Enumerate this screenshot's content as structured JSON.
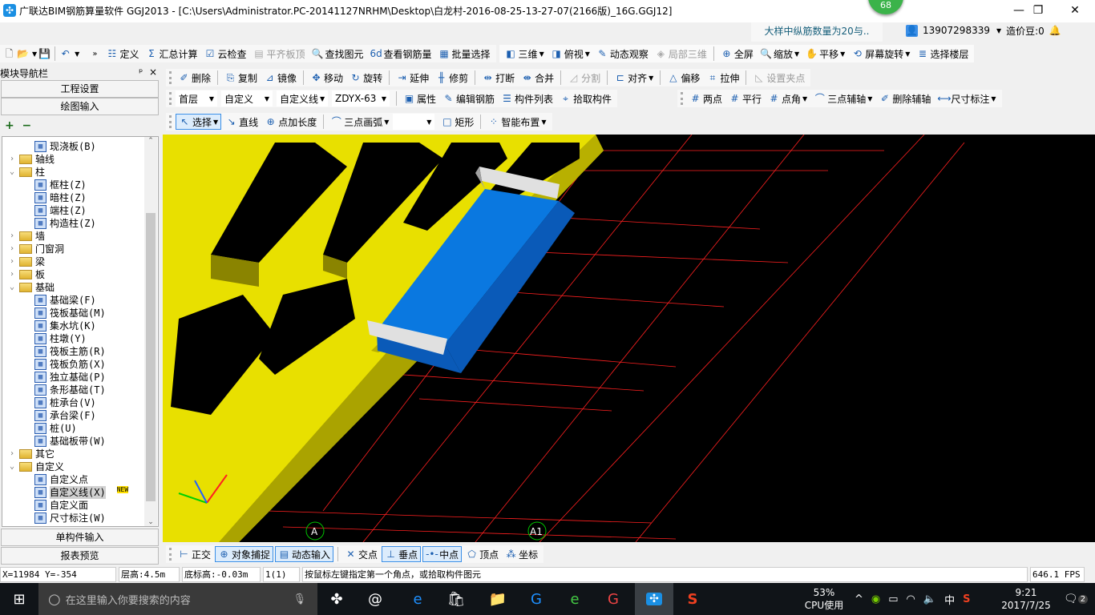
{
  "title": "广联达BIM钢筋算量软件 GGJ2013 - [C:\\Users\\Administrator.PC-20141127NRHM\\Desktop\\白龙村-2016-08-25-13-27-07(2166版)_16G.GGJ12]",
  "badge": "68",
  "window_controls": {
    "minimize": "—",
    "restore": "❐",
    "close": "✕"
  },
  "notice": "大样中纵筋数量为20与..",
  "user": "13907298339",
  "beans": "造价豆:0",
  "toolbar1": [
    "定义",
    "汇总计算",
    "云检查",
    "平齐板顶",
    "查找图元",
    "查看钢筋量",
    "批量选择"
  ],
  "toolbar_view": [
    "三维",
    "俯视",
    "动态观察",
    "局部三维",
    "全屏",
    "缩放",
    "平移",
    "屏幕旋转",
    "选择楼层"
  ],
  "toolbar_edit": [
    "删除",
    "复制",
    "镜像",
    "移动",
    "旋转",
    "延伸",
    "修剪",
    "打断",
    "合并",
    "分割",
    "对齐",
    "偏移",
    "拉伸",
    "设置夹点"
  ],
  "combos": {
    "floor": "首层",
    "type": "自定义",
    "subtype": "自定义线",
    "name": "ZDYX-63"
  },
  "toolbar_prop": [
    "属性",
    "编辑钢筋",
    "构件列表",
    "拾取构件"
  ],
  "toolbar_axis": [
    "两点",
    "平行",
    "点角",
    "三点辅轴",
    "删除辅轴",
    "尺寸标注"
  ],
  "toolbar_draw": [
    "选择",
    "直线",
    "点加长度",
    "三点画弧",
    "矩形",
    "智能布置"
  ],
  "left": {
    "header": "模块导航栏",
    "pin": "ᵖ",
    "close": "×",
    "project": "工程设置",
    "draw": "绘图输入",
    "single": "单构件输入",
    "report": "报表预览",
    "add": "+",
    "remove": "−"
  },
  "tree": [
    {
      "label": "现浇板(B)",
      "level": 2
    },
    {
      "label": "轴线",
      "level": 0,
      "folder": true,
      "exp": ">"
    },
    {
      "label": "柱",
      "level": 0,
      "folder": true,
      "exp": "v"
    },
    {
      "label": "框柱(Z)",
      "level": 2
    },
    {
      "label": "暗柱(Z)",
      "level": 2
    },
    {
      "label": "端柱(Z)",
      "level": 2
    },
    {
      "label": "构造柱(Z)",
      "level": 2
    },
    {
      "label": "墙",
      "level": 0,
      "folder": true,
      "exp": ">"
    },
    {
      "label": "门窗洞",
      "level": 0,
      "folder": true,
      "exp": ">"
    },
    {
      "label": "梁",
      "level": 0,
      "folder": true,
      "exp": ">"
    },
    {
      "label": "板",
      "level": 0,
      "folder": true,
      "exp": ">"
    },
    {
      "label": "基础",
      "level": 0,
      "folder": true,
      "exp": "v"
    },
    {
      "label": "基础梁(F)",
      "level": 2
    },
    {
      "label": "筏板基础(M)",
      "level": 2
    },
    {
      "label": "集水坑(K)",
      "level": 2
    },
    {
      "label": "柱墩(Y)",
      "level": 2
    },
    {
      "label": "筏板主筋(R)",
      "level": 2
    },
    {
      "label": "筏板负筋(X)",
      "level": 2
    },
    {
      "label": "独立基础(P)",
      "level": 2
    },
    {
      "label": "条形基础(T)",
      "level": 2
    },
    {
      "label": "桩承台(V)",
      "level": 2
    },
    {
      "label": "承台梁(F)",
      "level": 2
    },
    {
      "label": "桩(U)",
      "level": 2
    },
    {
      "label": "基础板带(W)",
      "level": 2
    },
    {
      "label": "其它",
      "level": 0,
      "folder": true,
      "exp": ">"
    },
    {
      "label": "自定义",
      "level": 0,
      "folder": true,
      "exp": "v"
    },
    {
      "label": "自定义点",
      "level": 2
    },
    {
      "label": "自定义线(X)",
      "level": 2,
      "selected": true,
      "new": "NEW"
    },
    {
      "label": "自定义面",
      "level": 2
    },
    {
      "label": "尺寸标注(W)",
      "level": 2
    }
  ],
  "axis_labels": [
    "A",
    "A1"
  ],
  "snap": [
    "正交",
    "对象捕捉",
    "动态输入",
    "交点",
    "垂点",
    "中点",
    "顶点",
    "坐标"
  ],
  "status": {
    "coords": "X=11984 Y=-354",
    "floor_height": "层高:4.5m",
    "bottom_elev": "底标高:-0.03m",
    "count": "1(1)",
    "hint": "按鼠标左键指定第一个角点，或拾取构件图元",
    "fps": "646.1 FPS"
  },
  "taskbar": {
    "search": "在这里输入你要搜索的内容",
    "cpu": "53%",
    "cpu_label": "CPU使用",
    "ime": "中",
    "time": "9:21",
    "date": "2017/7/25",
    "notifications": "2"
  },
  "colors": {
    "structure": "#e8e000",
    "slab": "#0a78e0",
    "grid": "#ff2020",
    "canvas": "#000000"
  }
}
